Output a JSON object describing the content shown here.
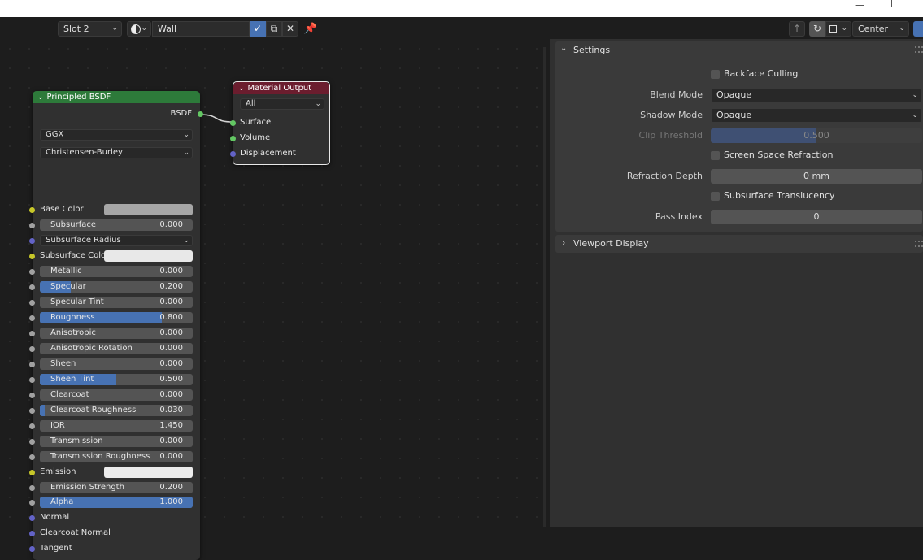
{
  "header": {
    "slot": "Slot 2",
    "material_name": "Wall",
    "pivot": "Center"
  },
  "principled": {
    "title": "Principled BSDF",
    "output": "BSDF",
    "distribution": "GGX",
    "subsurface_method": "Christensen-Burley",
    "base_color_label": "Base Color",
    "subsurface": {
      "label": "Subsurface",
      "value": "0.000"
    },
    "subsurface_radius": "Subsurface Radius",
    "subsurface_color_label": "Subsurface Colo",
    "metallic": {
      "label": "Metallic",
      "value": "0.000"
    },
    "specular": {
      "label": "Specular",
      "value": "0.200",
      "fraction": 0.2
    },
    "specular_tint": {
      "label": "Specular Tint",
      "value": "0.000"
    },
    "roughness": {
      "label": "Roughness",
      "value": "0.800",
      "fraction": 0.8
    },
    "anisotropic": {
      "label": "Anisotropic",
      "value": "0.000"
    },
    "anisotropic_rotation": {
      "label": "Anisotropic Rotation",
      "value": "0.000"
    },
    "sheen": {
      "label": "Sheen",
      "value": "0.000"
    },
    "sheen_tint": {
      "label": "Sheen Tint",
      "value": "0.500",
      "fraction": 0.5
    },
    "clearcoat": {
      "label": "Clearcoat",
      "value": "0.000"
    },
    "clearcoat_roughness": {
      "label": "Clearcoat Roughness",
      "value": "0.030",
      "fraction": 0.03
    },
    "ior": {
      "label": "IOR",
      "value": "1.450"
    },
    "transmission": {
      "label": "Transmission",
      "value": "0.000"
    },
    "transmission_roughness": {
      "label": "Transmission Roughness",
      "value": "0.000"
    },
    "emission_label": "Emission",
    "emission_strength": {
      "label": "Emission Strength",
      "value": "0.200"
    },
    "alpha": {
      "label": "Alpha",
      "value": "1.000",
      "fraction": 1.0
    },
    "normal": "Normal",
    "clearcoat_normal": "Clearcoat Normal",
    "tangent": "Tangent"
  },
  "output_node": {
    "title": "Material Output",
    "target": "All",
    "surface": "Surface",
    "volume": "Volume",
    "displacement": "Displacement"
  },
  "settings": {
    "title": "Settings",
    "backface_culling": "Backface Culling",
    "blend_mode_label": "Blend Mode",
    "blend_mode": "Opaque",
    "shadow_mode_label": "Shadow Mode",
    "shadow_mode": "Opaque",
    "clip_threshold_label": "Clip Threshold",
    "clip_threshold": "0.500",
    "clip_threshold_fraction": 0.5,
    "screen_space_refraction": "Screen Space Refraction",
    "refraction_depth_label": "Refraction Depth",
    "refraction_depth": "0 mm",
    "subsurface_translucency": "Subsurface Translucency",
    "pass_index_label": "Pass Index",
    "pass_index": "0"
  },
  "viewport_display": {
    "title": "Viewport Display"
  },
  "colors": {
    "node_shader_header": "#2d7a3a",
    "node_output_header": "#6b1d2e",
    "slider_fill": "#4772b3",
    "base_color": "#a6a6a6",
    "subsurface_color": "#e8e8e8",
    "emission_color": "#ececec"
  }
}
